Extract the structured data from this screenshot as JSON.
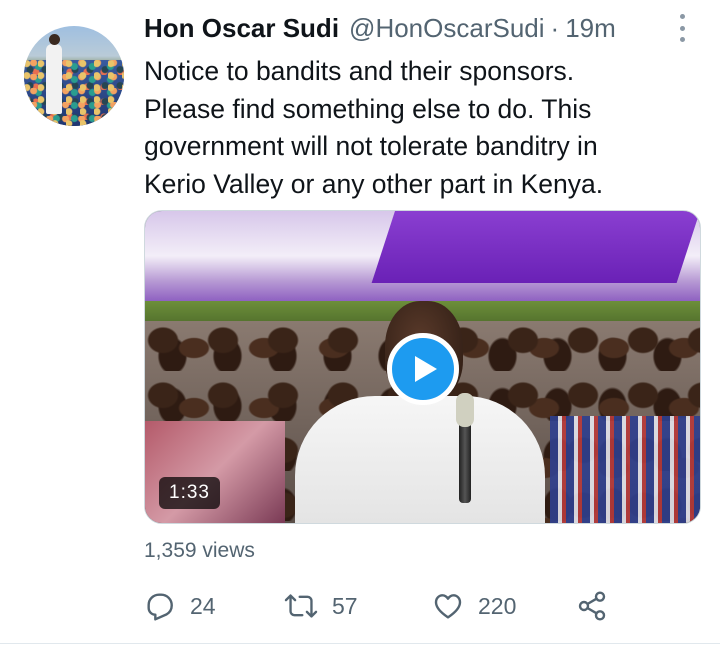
{
  "tweet": {
    "author": {
      "display_name": "Hon Oscar Sudi",
      "handle": "@HonOscarSudi",
      "separator": "·",
      "time": "19m"
    },
    "text_lines": [
      "Notice to bandits and their sponsors.",
      "Please find something else to do. This",
      "government will not tolerate banditry in",
      "Kerio Valley or any other part in Kenya."
    ],
    "media": {
      "type": "video",
      "duration": "1:33"
    },
    "views": "1,359 views",
    "actions": {
      "reply_count": "24",
      "retweet_count": "57",
      "like_count": "220"
    }
  },
  "icons": {
    "more": "more-vertical-icon",
    "reply": "reply-icon",
    "retweet": "retweet-icon",
    "like": "heart-icon",
    "share": "share-icon",
    "play": "play-icon"
  },
  "colors": {
    "accent": "#1d9bf0",
    "text": "#0f1419",
    "secondary": "#536471"
  }
}
